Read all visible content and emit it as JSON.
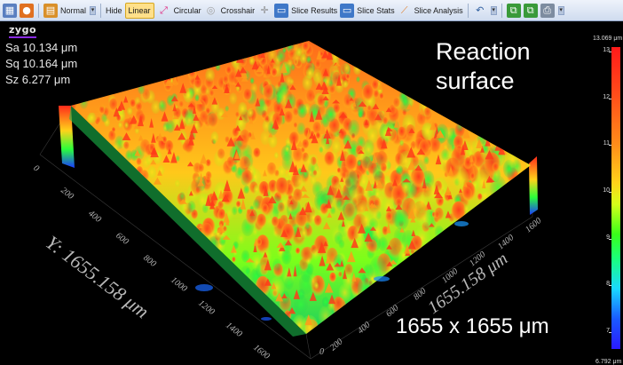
{
  "toolbar": {
    "normal_label": "Normal",
    "hide_label": "Hide",
    "linear_label": "Linear",
    "circular_label": "Circular",
    "crosshair_label": "Crosshair",
    "slice_results_label": "Slice Results",
    "slice_stats_label": "Slice Stats",
    "slice_analysis_label": "Slice Analysis"
  },
  "logo": "zygo",
  "stats": {
    "sa": "Sa 10.134 μm",
    "sq": "Sq 10.164 μm",
    "sz": "Sz 6.277  μm"
  },
  "annotation": {
    "title_line1": "Reaction",
    "title_line2": "surface",
    "dimensions": "1655 x 1655 μm"
  },
  "axes": {
    "y_title": "Y: 1655.158 μm",
    "x_title": "1655.158 μm",
    "y_ticks": [
      "0",
      "200",
      "400",
      "600",
      "800",
      "1000",
      "1200",
      "1400",
      "1600"
    ],
    "x_ticks": [
      "200",
      "400",
      "600",
      "800",
      "1000",
      "1200",
      "1400",
      "1600"
    ],
    "x_origin": "0"
  },
  "colorbar": {
    "max_label": "13.069 μm",
    "min_label": "6.792 μm",
    "ticks": [
      "13",
      "12",
      "11",
      "10",
      "9",
      "8",
      "7"
    ]
  }
}
